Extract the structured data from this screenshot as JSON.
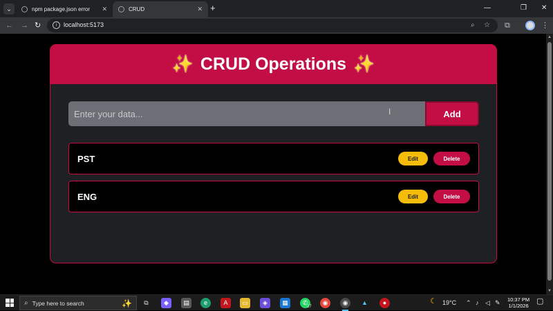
{
  "browser": {
    "tabs": [
      {
        "title": "npm package.json error",
        "active": false
      },
      {
        "title": "CRUD",
        "active": true
      }
    ],
    "url": "localhost:5173"
  },
  "app": {
    "title": "CRUD Operations",
    "sparkle": "✨",
    "input": {
      "value": "",
      "placeholder": "Enter your data..."
    },
    "add_label": "Add",
    "items": [
      {
        "text": "PST",
        "edit_label": "Edit",
        "delete_label": "Delete"
      },
      {
        "text": "ENG",
        "edit_label": "Edit",
        "delete_label": "Delete"
      }
    ]
  },
  "taskbar": {
    "search_placeholder": "Type here to search",
    "whatsapp_badge": "27",
    "weather": "19°C",
    "time": "10:37 PM",
    "date": "1/1/2026"
  },
  "colors": {
    "accent": "#c20d45",
    "edit": "#f5bd0a",
    "card_bg": "#1f2023"
  }
}
